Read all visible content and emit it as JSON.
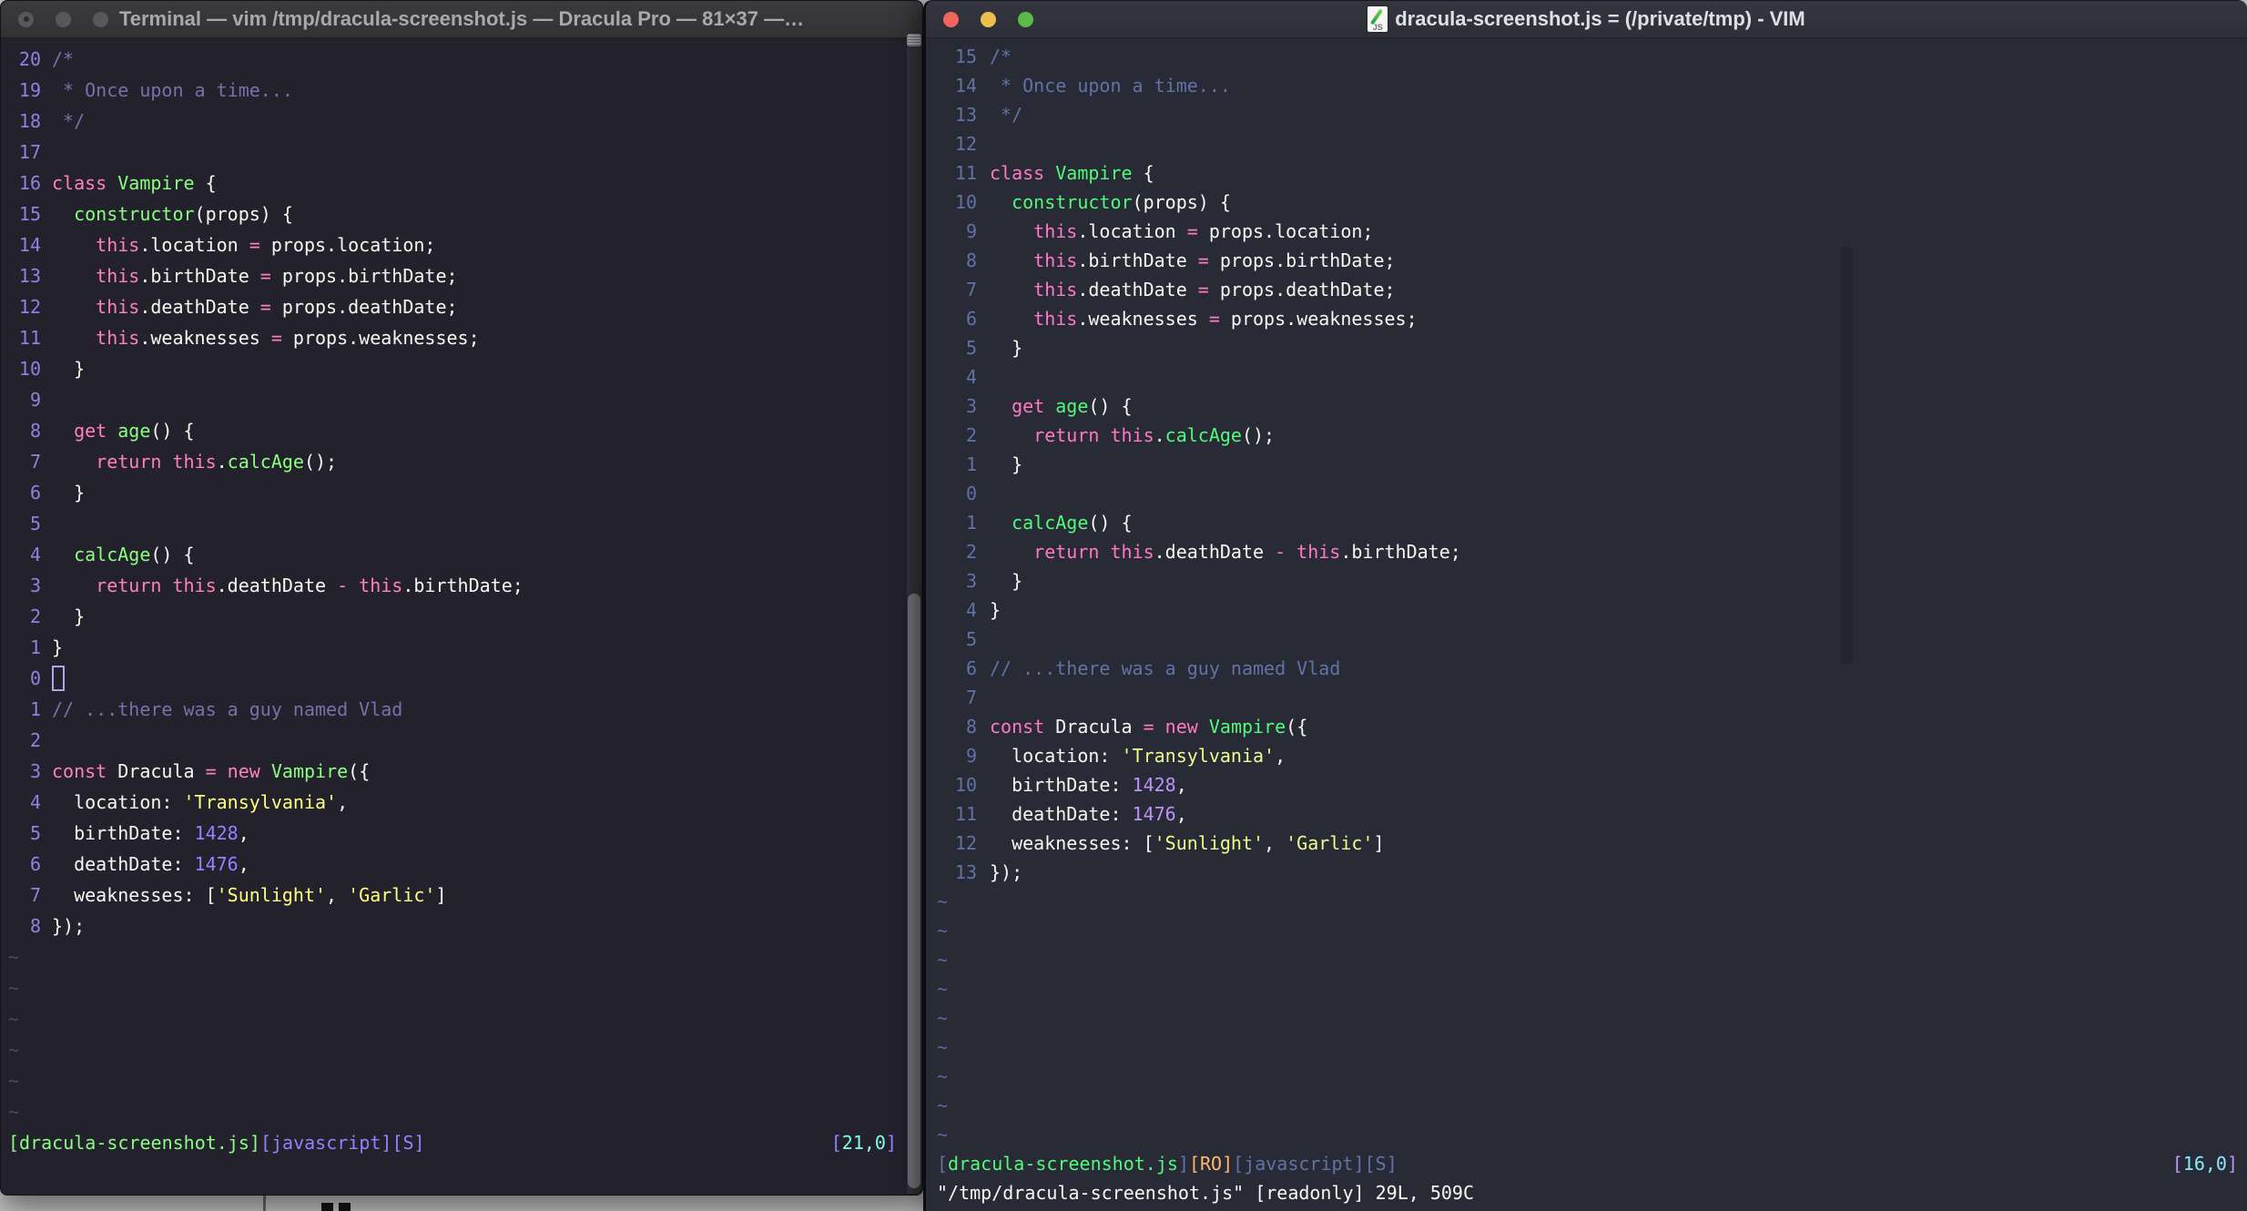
{
  "desktop": {
    "background_color": "#C9C9C9"
  },
  "left_window": {
    "app": "Terminal",
    "title": "Terminal — vim /tmp/dracula-screenshot.js — Dracula Pro — 81×37 —…",
    "theme_name": "Dracula Pro",
    "colors": {
      "bg": "#22212C",
      "fg": "#F8F8F2",
      "comment": "#7970A9",
      "pink": "#FF80BF",
      "green": "#8AFF80",
      "purple": "#9580FF",
      "yellow": "#FFFF80",
      "cyan": "#80FFEA",
      "line_number": "#8F82E0"
    },
    "window_controls": [
      "close",
      "minimize",
      "maximize"
    ],
    "lines": [
      {
        "num": "20",
        "segs": [
          [
            "c",
            "/*"
          ]
        ]
      },
      {
        "num": "19",
        "segs": [
          [
            "c",
            " * Once upon a time..."
          ]
        ]
      },
      {
        "num": "18",
        "segs": [
          [
            "c",
            " */"
          ]
        ]
      },
      {
        "num": "17",
        "segs": []
      },
      {
        "num": "16",
        "segs": [
          [
            "p",
            "class"
          ],
          [
            "f",
            " "
          ],
          [
            "g",
            "Vampire"
          ],
          [
            "f",
            " {"
          ]
        ]
      },
      {
        "num": "15",
        "segs": [
          [
            "g",
            "  constructor"
          ],
          [
            "f",
            "(props) {"
          ]
        ]
      },
      {
        "num": "14",
        "segs": [
          [
            "p",
            "    this"
          ],
          [
            "f",
            ".location "
          ],
          [
            "p",
            "="
          ],
          [
            "f",
            " props.location;"
          ]
        ]
      },
      {
        "num": "13",
        "segs": [
          [
            "p",
            "    this"
          ],
          [
            "f",
            ".birthDate "
          ],
          [
            "p",
            "="
          ],
          [
            "f",
            " props.birthDate;"
          ]
        ]
      },
      {
        "num": "12",
        "segs": [
          [
            "p",
            "    this"
          ],
          [
            "f",
            ".deathDate "
          ],
          [
            "p",
            "="
          ],
          [
            "f",
            " props.deathDate;"
          ]
        ]
      },
      {
        "num": "11",
        "segs": [
          [
            "p",
            "    this"
          ],
          [
            "f",
            ".weaknesses "
          ],
          [
            "p",
            "="
          ],
          [
            "f",
            " props.weaknesses;"
          ]
        ]
      },
      {
        "num": "10",
        "segs": [
          [
            "f",
            "  }"
          ]
        ]
      },
      {
        "num": "9",
        "segs": []
      },
      {
        "num": "8",
        "segs": [
          [
            "p",
            "  get"
          ],
          [
            "f",
            " "
          ],
          [
            "g",
            "age"
          ],
          [
            "f",
            "() {"
          ]
        ]
      },
      {
        "num": "7",
        "segs": [
          [
            "p",
            "    return this"
          ],
          [
            "f",
            "."
          ],
          [
            "g",
            "calcAge"
          ],
          [
            "f",
            "();"
          ]
        ]
      },
      {
        "num": "6",
        "segs": [
          [
            "f",
            "  }"
          ]
        ]
      },
      {
        "num": "5",
        "segs": []
      },
      {
        "num": "4",
        "segs": [
          [
            "g",
            "  calcAge"
          ],
          [
            "f",
            "() {"
          ]
        ]
      },
      {
        "num": "3",
        "segs": [
          [
            "p",
            "    return this"
          ],
          [
            "f",
            ".deathDate "
          ],
          [
            "p",
            "- this"
          ],
          [
            "f",
            ".birthDate;"
          ]
        ]
      },
      {
        "num": "2",
        "segs": [
          [
            "f",
            "  }"
          ]
        ]
      },
      {
        "num": "1",
        "segs": [
          [
            "f",
            "}"
          ]
        ]
      },
      {
        "num": "0",
        "cursor": true,
        "segs": []
      },
      {
        "num": "1",
        "segs": [
          [
            "c",
            "// ...there was a guy named Vlad"
          ]
        ]
      },
      {
        "num": "2",
        "segs": []
      },
      {
        "num": "3",
        "segs": [
          [
            "p",
            "const"
          ],
          [
            "f",
            " Dracula "
          ],
          [
            "p",
            "= new"
          ],
          [
            "f",
            " "
          ],
          [
            "g",
            "Vampire"
          ],
          [
            "f",
            "({"
          ]
        ]
      },
      {
        "num": "4",
        "segs": [
          [
            "f",
            "  location: "
          ],
          [
            "y",
            "'Transylvania'"
          ],
          [
            "f",
            ","
          ]
        ]
      },
      {
        "num": "5",
        "segs": [
          [
            "f",
            "  birthDate: "
          ],
          [
            "n",
            "1428"
          ],
          [
            "f",
            ","
          ]
        ]
      },
      {
        "num": "6",
        "segs": [
          [
            "f",
            "  deathDate: "
          ],
          [
            "n",
            "1476"
          ],
          [
            "f",
            ","
          ]
        ]
      },
      {
        "num": "7",
        "segs": [
          [
            "f",
            "  weaknesses: ["
          ],
          [
            "y",
            "'Sunlight'"
          ],
          [
            "f",
            ", "
          ],
          [
            "y",
            "'Garlic'"
          ],
          [
            "f",
            "]"
          ]
        ]
      },
      {
        "num": "8",
        "segs": [
          [
            "f",
            "});"
          ]
        ]
      },
      {
        "tilde": true
      },
      {
        "tilde": true
      },
      {
        "tilde": true
      },
      {
        "tilde": true
      },
      {
        "tilde": true
      },
      {
        "tilde": true
      }
    ],
    "status_left": [
      [
        "g",
        "[dracula-screenshot.js]"
      ],
      [
        "n",
        "[javascript][S]"
      ]
    ],
    "status_right": [
      [
        "n",
        "["
      ],
      [
        "cy",
        "21,0"
      ],
      [
        "n",
        "]"
      ]
    ],
    "command_line": ""
  },
  "right_window": {
    "app": "MacVim",
    "title": "dracula-screenshot.js = (/private/tmp) - VIM",
    "doc_icon_label": "JS",
    "colors": {
      "bg": "#282A36",
      "fg": "#F8F8F2",
      "comment": "#6272A4",
      "pink": "#FF79C6",
      "green": "#50FA7B",
      "purple": "#BD93F9",
      "yellow": "#F1FA8C",
      "cyan": "#8BE9FD",
      "orange": "#FFB86C",
      "line_number": "#6272A4"
    },
    "window_controls": [
      "close",
      "minimize",
      "maximize"
    ],
    "lines": [
      {
        "num": "15",
        "segs": [
          [
            "c",
            "/*"
          ]
        ]
      },
      {
        "num": "14",
        "segs": [
          [
            "c",
            " * Once upon a time..."
          ]
        ]
      },
      {
        "num": "13",
        "segs": [
          [
            "c",
            " */"
          ]
        ]
      },
      {
        "num": "12",
        "segs": []
      },
      {
        "num": "11",
        "segs": [
          [
            "p",
            "class"
          ],
          [
            "f",
            " "
          ],
          [
            "g",
            "Vampire"
          ],
          [
            "f",
            " {"
          ]
        ]
      },
      {
        "num": "10",
        "segs": [
          [
            "g",
            "  constructor"
          ],
          [
            "f",
            "(props) {"
          ]
        ]
      },
      {
        "num": "9",
        "segs": [
          [
            "p",
            "    this"
          ],
          [
            "f",
            ".location "
          ],
          [
            "p",
            "="
          ],
          [
            "f",
            " props.location;"
          ]
        ]
      },
      {
        "num": "8",
        "segs": [
          [
            "p",
            "    this"
          ],
          [
            "f",
            ".birthDate "
          ],
          [
            "p",
            "="
          ],
          [
            "f",
            " props.birthDate;"
          ]
        ]
      },
      {
        "num": "7",
        "segs": [
          [
            "p",
            "    this"
          ],
          [
            "f",
            ".deathDate "
          ],
          [
            "p",
            "="
          ],
          [
            "f",
            " props.deathDate;"
          ]
        ]
      },
      {
        "num": "6",
        "segs": [
          [
            "p",
            "    this"
          ],
          [
            "f",
            ".weaknesses "
          ],
          [
            "p",
            "="
          ],
          [
            "f",
            " props.weaknesses;"
          ]
        ]
      },
      {
        "num": "5",
        "segs": [
          [
            "f",
            "  }"
          ]
        ]
      },
      {
        "num": "4",
        "segs": []
      },
      {
        "num": "3",
        "segs": [
          [
            "p",
            "  get"
          ],
          [
            "f",
            " "
          ],
          [
            "g",
            "age"
          ],
          [
            "f",
            "() {"
          ]
        ]
      },
      {
        "num": "2",
        "segs": [
          [
            "p",
            "    return this"
          ],
          [
            "f",
            "."
          ],
          [
            "g",
            "calcAge"
          ],
          [
            "f",
            "();"
          ]
        ]
      },
      {
        "num": "1",
        "segs": [
          [
            "f",
            "  }"
          ]
        ]
      },
      {
        "num": "0",
        "segs": []
      },
      {
        "num": "1",
        "segs": [
          [
            "g",
            "  calcAge"
          ],
          [
            "f",
            "() {"
          ]
        ]
      },
      {
        "num": "2",
        "segs": [
          [
            "p",
            "    return this"
          ],
          [
            "f",
            ".deathDate "
          ],
          [
            "p",
            "- this"
          ],
          [
            "f",
            ".birthDate;"
          ]
        ]
      },
      {
        "num": "3",
        "segs": [
          [
            "f",
            "  }"
          ]
        ]
      },
      {
        "num": "4",
        "segs": [
          [
            "f",
            "}"
          ]
        ]
      },
      {
        "num": "5",
        "segs": []
      },
      {
        "num": "6",
        "segs": [
          [
            "c",
            "// ...there was a guy named Vlad"
          ]
        ]
      },
      {
        "num": "7",
        "segs": []
      },
      {
        "num": "8",
        "segs": [
          [
            "p",
            "const"
          ],
          [
            "f",
            " Dracula "
          ],
          [
            "p",
            "= new"
          ],
          [
            "f",
            " "
          ],
          [
            "g",
            "Vampire"
          ],
          [
            "f",
            "({"
          ]
        ]
      },
      {
        "num": "9",
        "segs": [
          [
            "f",
            "  location: "
          ],
          [
            "y",
            "'Transylvania'"
          ],
          [
            "f",
            ","
          ]
        ]
      },
      {
        "num": "10",
        "segs": [
          [
            "f",
            "  birthDate: "
          ],
          [
            "n",
            "1428"
          ],
          [
            "f",
            ","
          ]
        ]
      },
      {
        "num": "11",
        "segs": [
          [
            "f",
            "  deathDate: "
          ],
          [
            "n",
            "1476"
          ],
          [
            "f",
            ","
          ]
        ]
      },
      {
        "num": "12",
        "segs": [
          [
            "f",
            "  weaknesses: ["
          ],
          [
            "y",
            "'Sunlight'"
          ],
          [
            "f",
            ", "
          ],
          [
            "y",
            "'Garlic'"
          ],
          [
            "f",
            "]"
          ]
        ]
      },
      {
        "num": "13",
        "segs": [
          [
            "f",
            "});"
          ]
        ]
      },
      {
        "tilde": true
      },
      {
        "tilde": true
      },
      {
        "tilde": true
      },
      {
        "tilde": true
      },
      {
        "tilde": true
      },
      {
        "tilde": true
      },
      {
        "tilde": true
      },
      {
        "tilde": true
      },
      {
        "tilde": true
      }
    ],
    "status_left": [
      [
        "c",
        "["
      ],
      [
        "g",
        "dracula-screenshot.js"
      ],
      [
        "c",
        "]"
      ],
      [
        "o",
        "[RO]"
      ],
      [
        "c",
        "[javascript][S]"
      ]
    ],
    "status_right": [
      [
        "n",
        "["
      ],
      [
        "cy",
        "16,0"
      ],
      [
        "n",
        "]"
      ]
    ],
    "command_line": "\"/tmp/dracula-screenshot.js\" [readonly] 29L, 509C"
  }
}
